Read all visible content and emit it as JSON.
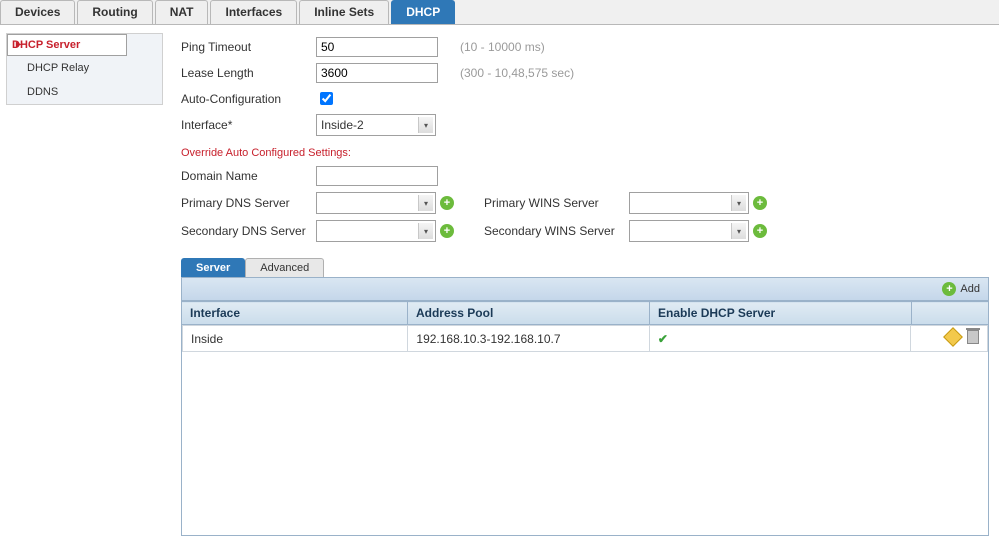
{
  "tabs": {
    "devices": "Devices",
    "routing": "Routing",
    "nat": "NAT",
    "interfaces": "Interfaces",
    "inline": "Inline Sets",
    "dhcp": "DHCP"
  },
  "sidebar": {
    "items": [
      "DHCP Server",
      "DHCP Relay",
      "DDNS"
    ]
  },
  "form": {
    "ping_label": "Ping Timeout",
    "ping_value": "50",
    "ping_hint": "(10 - 10000 ms)",
    "lease_label": "Lease Length",
    "lease_value": "3600",
    "lease_hint": "(300 - 10,48,575 sec)",
    "auto_label": "Auto-Configuration",
    "auto_checked": true,
    "iface_label": "Interface*",
    "iface_value": "Inside-2",
    "override_label": "Override Auto Configured Settings:",
    "domain_label": "Domain Name",
    "domain_value": "",
    "pdns_label": "Primary DNS Server",
    "pdns_value": "",
    "sdns_label": "Secondary DNS Server",
    "sdns_value": "",
    "pwins_label": "Primary WINS Server",
    "pwins_value": "",
    "swins_label": "Secondary WINS Server",
    "swins_value": ""
  },
  "subtabs": {
    "server": "Server",
    "advanced": "Advanced"
  },
  "add_label": "Add",
  "table": {
    "cols": {
      "iface": "Interface",
      "pool": "Address Pool",
      "enable": "Enable DHCP Server"
    },
    "rows": [
      {
        "iface": "Inside",
        "pool": "192.168.10.3-192.168.10.7",
        "enable": true
      }
    ]
  },
  "chart_data": null
}
